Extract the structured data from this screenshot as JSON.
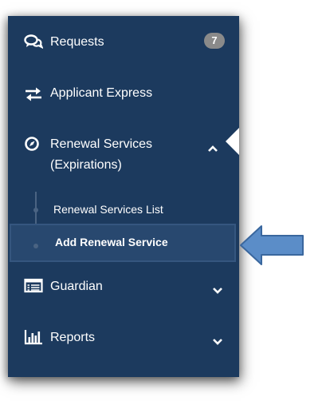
{
  "sidebar": {
    "requests": {
      "label": "Requests",
      "badge": "7",
      "icon": "chat-bubbles-icon"
    },
    "applicant_express": {
      "label": "Applicant Express",
      "icon": "swap-arrows-icon"
    },
    "renewal_services": {
      "label_line1": "Renewal Services",
      "label_line2": "(Expirations)",
      "icon": "compass-icon",
      "expanded": true,
      "children": [
        {
          "label": "Renewal Services List",
          "active": false
        },
        {
          "label": "Add Renewal Service",
          "active": true
        }
      ]
    },
    "guardian": {
      "label": "Guardian",
      "icon": "table-list-icon"
    },
    "reports": {
      "label": "Reports",
      "icon": "bar-chart-icon"
    }
  },
  "colors": {
    "sidebar_bg": "#1c3a5e",
    "active_bg": "#28486f",
    "badge_bg": "#8a8a8a",
    "pointer_arrow": "#5b8dc8"
  }
}
